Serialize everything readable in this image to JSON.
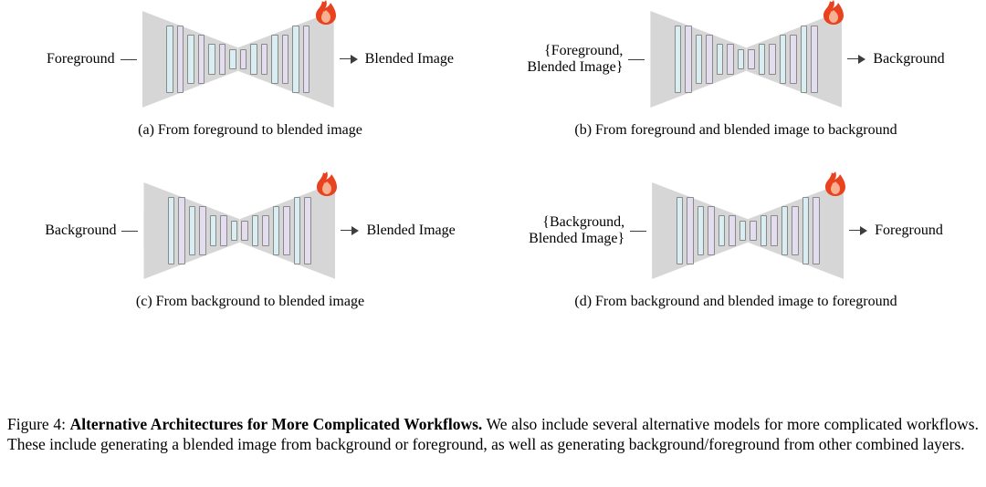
{
  "figure_ref": "Figure 4",
  "figure_title": "Alternative Architectures for More Complicated Workflows.",
  "figure_body": "We also include several alternative models for more complicated workflows. These include generating a blended image from background or foreground, as well as generating background/foreground from other combined layers.",
  "panels": {
    "a": {
      "input": "Foreground",
      "output": "Blended Image",
      "caption": "(a) From foreground to blended image"
    },
    "b": {
      "input": "{Foreground,\nBlended Image}",
      "output": "Background",
      "caption": "(b) From foreground and blended image to background"
    },
    "c": {
      "input": "Background",
      "output": "Blended Image",
      "caption": "(c) From background to blended image"
    },
    "d": {
      "input": "{Background,\nBlended Image}",
      "output": "Foreground",
      "caption": "(d) From background and blended image to foreground"
    }
  },
  "icons": {
    "fire": "fire-icon"
  },
  "colors": {
    "trapezoid": "#d6d6d6",
    "bar_blue": "#d9eef2",
    "bar_purple": "#e4ddef",
    "fire": "#e8421f"
  }
}
